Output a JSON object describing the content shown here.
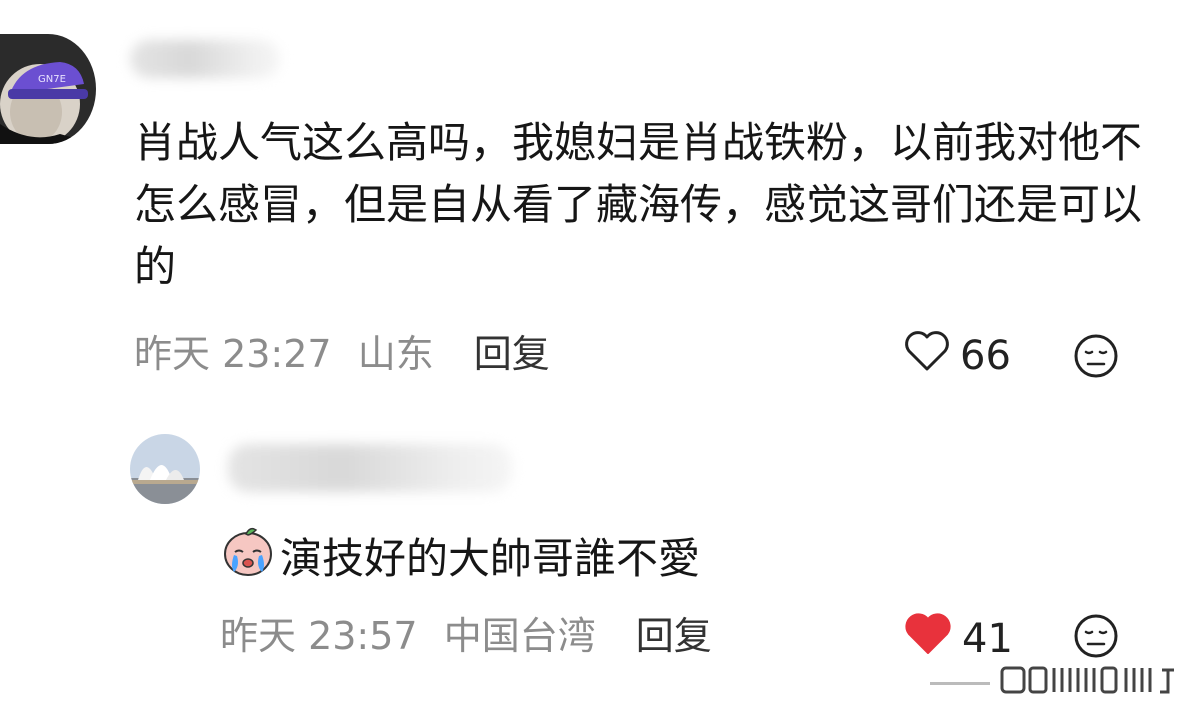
{
  "comments": [
    {
      "content": "肖战人气这么高吗，我媳妇是肖战铁粉，以前我对他不怎么感冒，但是自从看了藏海传，感觉这哥们还是可以的",
      "time": "昨天 23:27",
      "location": "山东",
      "reply_label": "回复",
      "likes": "66",
      "liked": false,
      "avatar_icon": "person-with-cap-avatar",
      "dislike_icon": "neutral-face-icon"
    },
    {
      "author_initial": ""
    }
  ],
  "replies": [
    {
      "content": "演技好的大帥哥誰不愛",
      "time": "昨天 23:57",
      "location": "中国台湾",
      "reply_label": "回复",
      "likes": "41",
      "liked": true,
      "emoji": "crying-peach-emoji",
      "avatar_icon": "sydney-opera-house-avatar",
      "dislike_icon": "neutral-face-icon",
      "heart_color": "#e8323c"
    }
  ],
  "colors": {
    "text": "#161616",
    "meta": "#8c8c8c",
    "liked_heart": "#e8323c"
  }
}
